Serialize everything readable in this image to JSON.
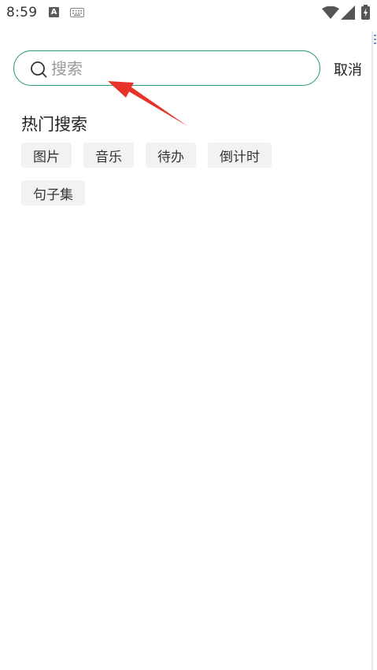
{
  "status_bar": {
    "time": "8:59",
    "a_badge": "A",
    "icons": [
      "keyboard-icon",
      "wifi-icon",
      "signal-icon",
      "battery-icon"
    ]
  },
  "search": {
    "placeholder": "搜索",
    "value": "",
    "cancel_label": "取消",
    "border_color": "#2f9a77"
  },
  "hot": {
    "title": "热门搜索",
    "tags": [
      "图片",
      "音乐",
      "待办",
      "倒计时",
      "句子集"
    ]
  },
  "annotation": {
    "color": "#e8332a",
    "icon": "red-arrow-icon"
  }
}
